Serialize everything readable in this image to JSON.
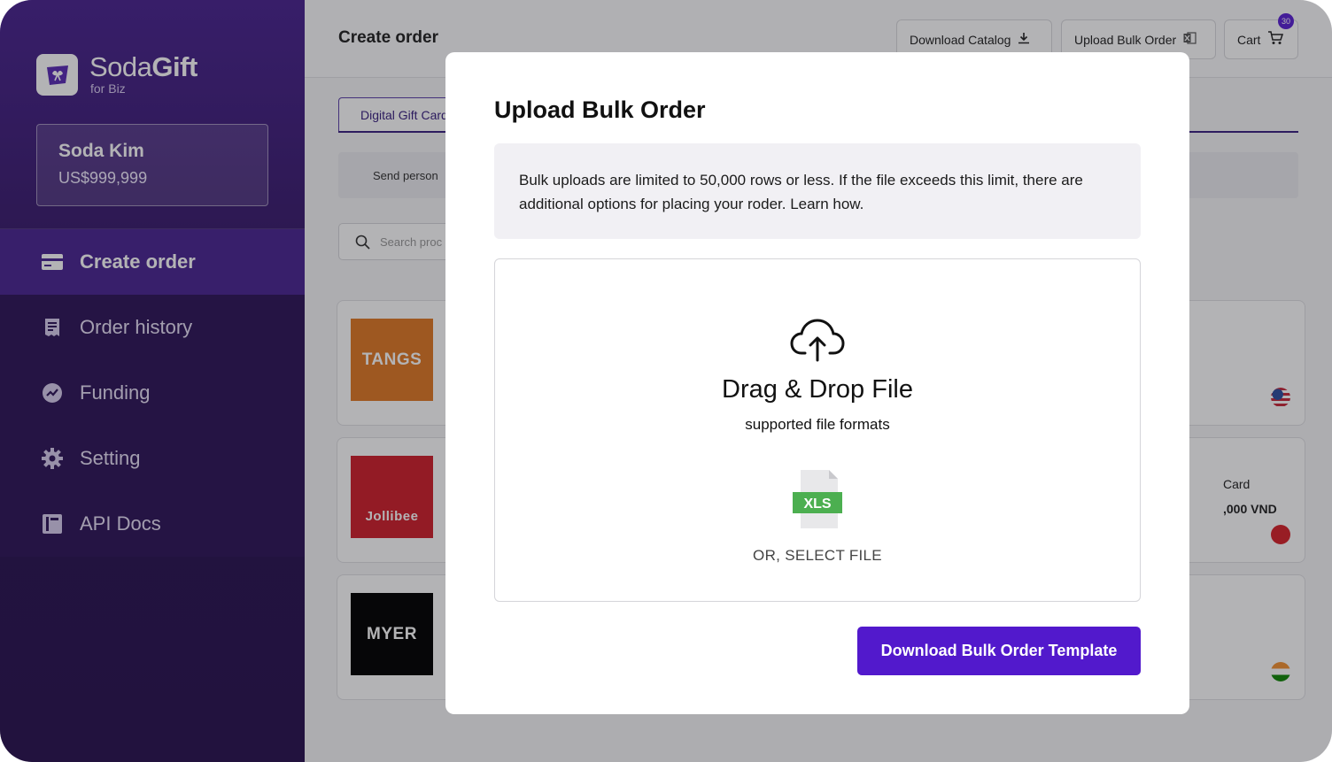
{
  "brand": {
    "name_light": "Soda",
    "name_bold": "Gift",
    "sub": "for Biz"
  },
  "account": {
    "name": "Soda Kim",
    "balance": "US$999,999"
  },
  "nav": [
    {
      "label": "Create order",
      "icon": "card-icon",
      "active": true
    },
    {
      "label": "Order history",
      "icon": "receipt-icon",
      "active": false
    },
    {
      "label": "Funding",
      "icon": "chart-icon",
      "active": false
    },
    {
      "label": "Setting",
      "icon": "gear-icon",
      "active": false
    },
    {
      "label": "API Docs",
      "icon": "book-icon",
      "active": false
    }
  ],
  "header": {
    "title": "Create order",
    "download_catalog": "Download Catalog",
    "upload_bulk": "Upload Bulk Order",
    "cart": "Cart",
    "cart_count": "30"
  },
  "tabs": {
    "digital": "Digital Gift Card"
  },
  "filter": {
    "send_text": "Send person"
  },
  "search": {
    "placeholder": "Search proc"
  },
  "cards": [
    {
      "brand": "TANGS",
      "color": "#e07a25",
      "flag": "us"
    },
    {
      "brand": "Jollibee",
      "color": "#d01f2b",
      "flag": "vn",
      "partial_title": "Card",
      "partial_price": ",000 VND"
    },
    {
      "brand": "MYER",
      "color": "#000000",
      "flag": "in"
    }
  ],
  "modal": {
    "title": "Upload Bulk Order",
    "notice": "Bulk uploads are limited to 50,000 rows or less. If the file exceeds this limit, there are additional options for placing your roder. Learn how.",
    "drop_title": "Drag & Drop File",
    "drop_sub": "supported file formats",
    "file_badge": "XLS",
    "select": "OR, SELECT FILE",
    "download_template": "Download Bulk Order Template"
  },
  "colors": {
    "accent": "#5219cc",
    "sidebar": "#3a1c6e"
  }
}
